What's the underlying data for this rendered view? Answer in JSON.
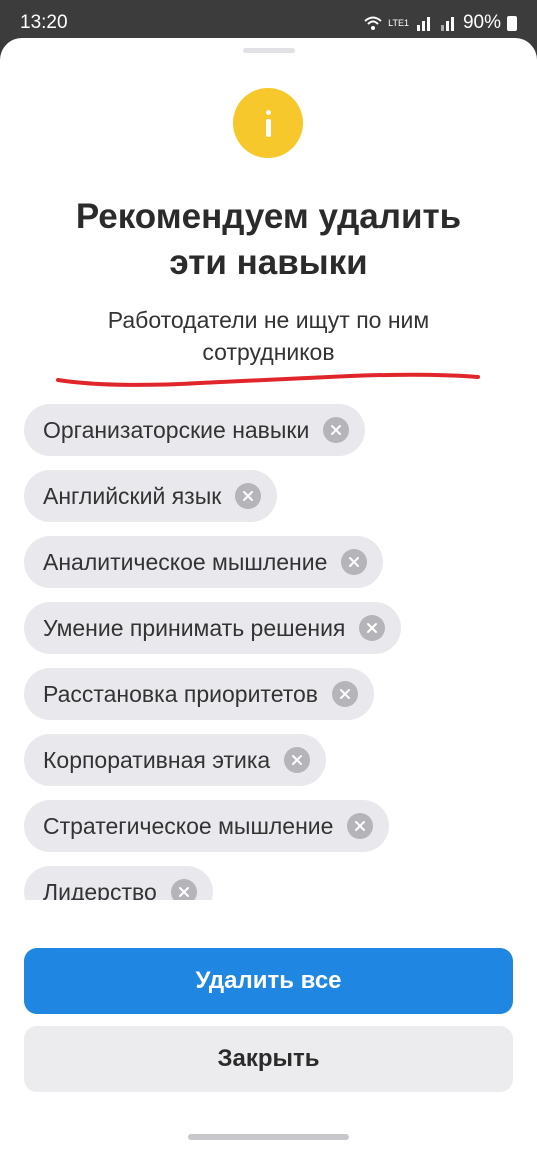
{
  "status": {
    "time": "13:20",
    "battery": "90%",
    "network_label": "LTE1"
  },
  "dialog": {
    "title_line1": "Рекомендуем удалить",
    "title_line2": "эти навыки",
    "subtitle_line1": "Работодатели не ищут по ним",
    "subtitle_line2": "сотрудников",
    "underline_color": "#e0262b",
    "icon": "info-icon",
    "icon_color": "#f7c82b"
  },
  "skills": [
    {
      "label": "Организаторские навыки"
    },
    {
      "label": "Английский язык"
    },
    {
      "label": "Аналитическое мышление"
    },
    {
      "label": "Умение принимать решения"
    },
    {
      "label": "Расстановка приоритетов"
    },
    {
      "label": "Корпоративная этика"
    },
    {
      "label": "Стратегическое мышление"
    },
    {
      "label": "Лидерство"
    }
  ],
  "actions": {
    "delete_all_label": "Удалить все",
    "close_label": "Закрыть",
    "primary_color": "#1f86e2"
  }
}
